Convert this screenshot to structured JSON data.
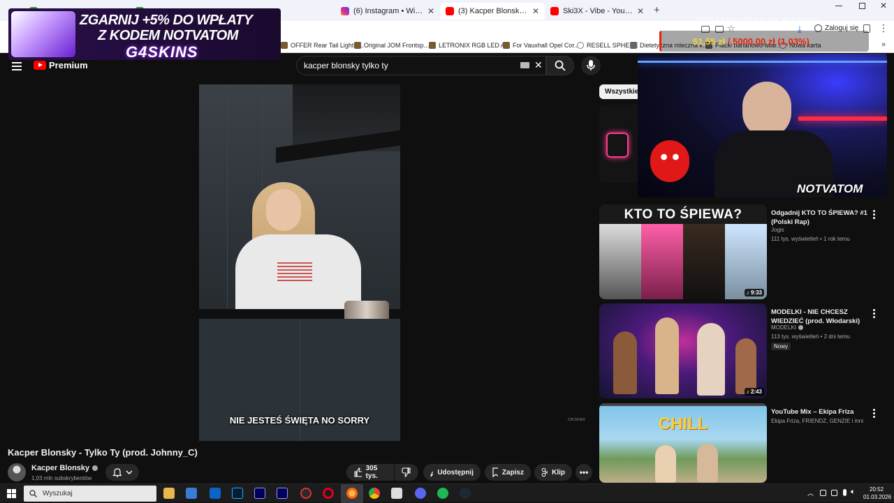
{
  "browser": {
    "tabs": [
      {
        "title": "",
        "color": "#3c9d3c"
      },
      {
        "title": "",
        "color": "#3c9d3c"
      },
      {
        "title": "(6) Instagram • Wiadomości",
        "color": "#d6249f"
      },
      {
        "title": "(3) Kacper Blonsky - Tylko Ty (p",
        "color": "#ff0000"
      },
      {
        "title": "Ski3X - Vibe - YouTube",
        "color": "#ff0000"
      }
    ],
    "new_tab": "+",
    "close_glyph": "✕",
    "sign_in": "Zaloguj się",
    "bookmarks": [
      "OFFER Rear Tail Lights ...",
      "Original JOM Frontsp...",
      "LETRONIX RGB LED A...",
      "For Vauxhall Opel Cor...",
      "RESELL SPHERE",
      "Dietetyczna mleczna k...",
      "Placki bananowo-twar...",
      "Nowa karta"
    ]
  },
  "youtube": {
    "logo": "Premium",
    "search_value": "kacper blonsky tylko ty",
    "filter_chip": "Wszystkie",
    "video": {
      "caption": "NIE JESTEŚ ŚWIĘTA NO SORRY",
      "watermark": "CRUSHER",
      "title": "Kacper Blonsky - Tylko Ty (prod. Johnny_C)",
      "channel": "Kacper Blonsky",
      "subscribers": "1,03 mln subskrybentów",
      "likes": "305 tys.",
      "share": "Udostępnij",
      "save": "Zapisz",
      "clip": "Klip"
    },
    "recommendations": [
      {
        "title": "Odgadnij KTO TO ŚPIEWA? #1 (Polski Rap)",
        "channel": "Jogis",
        "meta": "111 tys. wyświetleń • 1 rok temu",
        "duration": "♪ 9:33",
        "thumb_text": "KTO TO ŚPIEWA?"
      },
      {
        "title": "MODELKI - NIE CHCESZ WIEDZIEĆ (prod. Włodarski)",
        "channel": "MODELKI",
        "meta": "113 tys. wyświetleń • 2 dni temu",
        "badge": "Nowy",
        "duration": "♪ 2:43"
      },
      {
        "title": "YouTube Mix – Ekipa Friza",
        "channel": "Ekipa Friza, FRIENDZ, GENZIE i inni",
        "thumb_text": "CHILL"
      }
    ]
  },
  "overlays": {
    "promo_line1": "ZGARNIJ +5% DO WPŁATY",
    "promo_line2": "Z KODEM NOTVATOM",
    "promo_line3": "G4SKINS",
    "goal_title": "REHABILITACJA BARKU",
    "goal_current": "51,55 zł",
    "goal_target": "/ 5000,00 zł (1,03%)",
    "goal_progress": 0.0103,
    "cam_label": "NOTVATOM"
  },
  "taskbar": {
    "search_placeholder": "Wyszukaj",
    "time": "20:52",
    "date": "01.03.2026"
  }
}
